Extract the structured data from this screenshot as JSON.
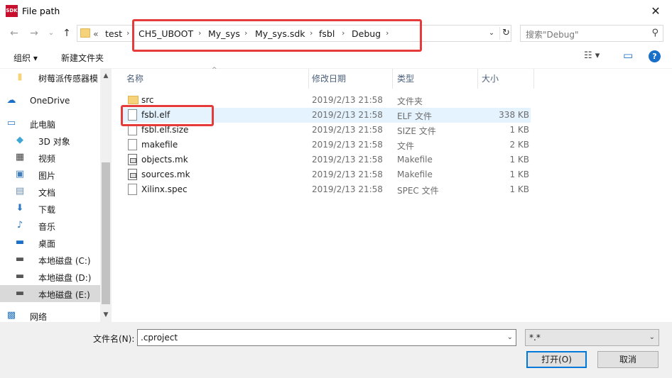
{
  "window": {
    "title": "File path",
    "app_icon_text": "SDK",
    "close_glyph": "✕"
  },
  "nav": {
    "back_glyph": "←",
    "forward_glyph": "→",
    "recent_glyph": "⌄",
    "up_glyph": "↑",
    "overflow": "«",
    "breadcrumbs": [
      "test",
      "CH5_UBOOT",
      "My_sys",
      "My_sys.sdk",
      "fsbl",
      "Debug"
    ],
    "sep_glyph": "›",
    "dropdown_glyph": "⌄",
    "refresh_glyph": "↻",
    "search_placeholder": "搜索\"Debug\"",
    "search_glyph": "⚲"
  },
  "toolbar": {
    "organize": "组织 ▾",
    "new_folder": "新建文件夹",
    "view_glyph": "☷ ▾",
    "pane_glyph": "▭",
    "help": "?"
  },
  "sidebar": {
    "items": [
      {
        "label": "树莓派传感器模",
        "icon": "folder-icon",
        "glyph": "▮",
        "color": "#f6d37b",
        "selected": false
      },
      {
        "label": "OneDrive",
        "icon": "cloud-icon",
        "glyph": "☁",
        "color": "#1a6fc9",
        "selected": false
      },
      {
        "label": "此电脑",
        "icon": "computer-icon",
        "glyph": "▭",
        "color": "#2b79c2",
        "selected": false
      },
      {
        "label": "3D 对象",
        "icon": "cube-icon",
        "glyph": "◆",
        "color": "#3fa7d6",
        "selected": false
      },
      {
        "label": "视频",
        "icon": "video-icon",
        "glyph": "▦",
        "color": "#444444",
        "selected": false
      },
      {
        "label": "图片",
        "icon": "picture-icon",
        "glyph": "▣",
        "color": "#3f7fbf",
        "selected": false
      },
      {
        "label": "文档",
        "icon": "document-icon",
        "glyph": "▤",
        "color": "#6d8fb3",
        "selected": false
      },
      {
        "label": "下载",
        "icon": "download-icon",
        "glyph": "⬇",
        "color": "#2b79c2",
        "selected": false
      },
      {
        "label": "音乐",
        "icon": "music-icon",
        "glyph": "♪",
        "color": "#2b79c2",
        "selected": false
      },
      {
        "label": "桌面",
        "icon": "desktop-icon",
        "glyph": "▬",
        "color": "#1a6fc9",
        "selected": false
      },
      {
        "label": "本地磁盘 (C:)",
        "icon": "drive-c-icon",
        "glyph": "▬",
        "color": "#555555",
        "selected": false
      },
      {
        "label": "本地磁盘 (D:)",
        "icon": "drive-d-icon",
        "glyph": "▬",
        "color": "#555555",
        "selected": false
      },
      {
        "label": "本地磁盘 (E:)",
        "icon": "drive-e-icon",
        "glyph": "▬",
        "color": "#555555",
        "selected": true
      },
      {
        "label": "网络",
        "icon": "network-icon",
        "glyph": "▩",
        "color": "#2b79c2",
        "selected": false
      }
    ]
  },
  "filelist": {
    "columns": {
      "name": "名称",
      "date": "修改日期",
      "type": "类型",
      "size": "大小"
    },
    "rows": [
      {
        "name": "src",
        "date": "2019/2/13 21:58",
        "type": "文件夹",
        "size": "",
        "icon": "folder"
      },
      {
        "name": "fsbl.elf",
        "date": "2019/2/13 21:58",
        "type": "ELF 文件",
        "size": "338 KB",
        "icon": "file"
      },
      {
        "name": "fsbl.elf.size",
        "date": "2019/2/13 21:58",
        "type": "SIZE 文件",
        "size": "1 KB",
        "icon": "file"
      },
      {
        "name": "makefile",
        "date": "2019/2/13 21:58",
        "type": "文件",
        "size": "2 KB",
        "icon": "file"
      },
      {
        "name": "objects.mk",
        "date": "2019/2/13 21:58",
        "type": "Makefile",
        "size": "1 KB",
        "icon": "mk"
      },
      {
        "name": "sources.mk",
        "date": "2019/2/13 21:58",
        "type": "Makefile",
        "size": "1 KB",
        "icon": "mk"
      },
      {
        "name": "Xilinx.spec",
        "date": "2019/2/13 21:58",
        "type": "SPEC 文件",
        "size": "1 KB",
        "icon": "file"
      }
    ]
  },
  "footer": {
    "filename_label": "文件名(N):",
    "filename_value": ".cproject",
    "filter_value": "*.*",
    "open_button": "打开(O)",
    "cancel_button": "取消"
  },
  "annotation_color": "#e53b3b"
}
